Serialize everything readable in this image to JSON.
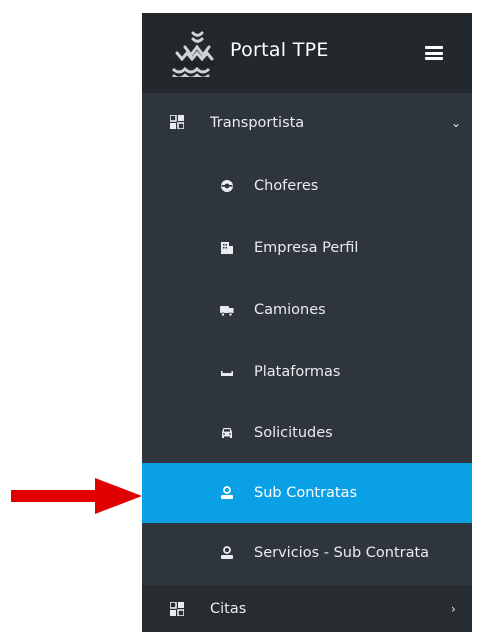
{
  "app": {
    "title": "Portal TPE"
  },
  "colors": {
    "sidebar": "#2f353c",
    "brand": "#23282d",
    "active": "#0aa0e6",
    "arrow": "#e00000"
  },
  "sidebar": {
    "group": {
      "label": "Transportista",
      "icon": "grid-icon",
      "expanded": true
    },
    "items": [
      {
        "label": "Choferes",
        "icon": "driver-icon"
      },
      {
        "label": "Empresa Perfil",
        "icon": "building-icon"
      },
      {
        "label": "Camiones",
        "icon": "truck-icon"
      },
      {
        "label": "Plataformas",
        "icon": "platform-icon"
      },
      {
        "label": "Solicitudes",
        "icon": "car-icon"
      },
      {
        "label": "Sub Contratas",
        "icon": "user-icon",
        "active": true
      },
      {
        "label": "Servicios - Sub Contrata",
        "icon": "user-icon"
      }
    ],
    "group2": {
      "label": "Citas",
      "icon": "grid-icon",
      "expanded": false
    }
  }
}
